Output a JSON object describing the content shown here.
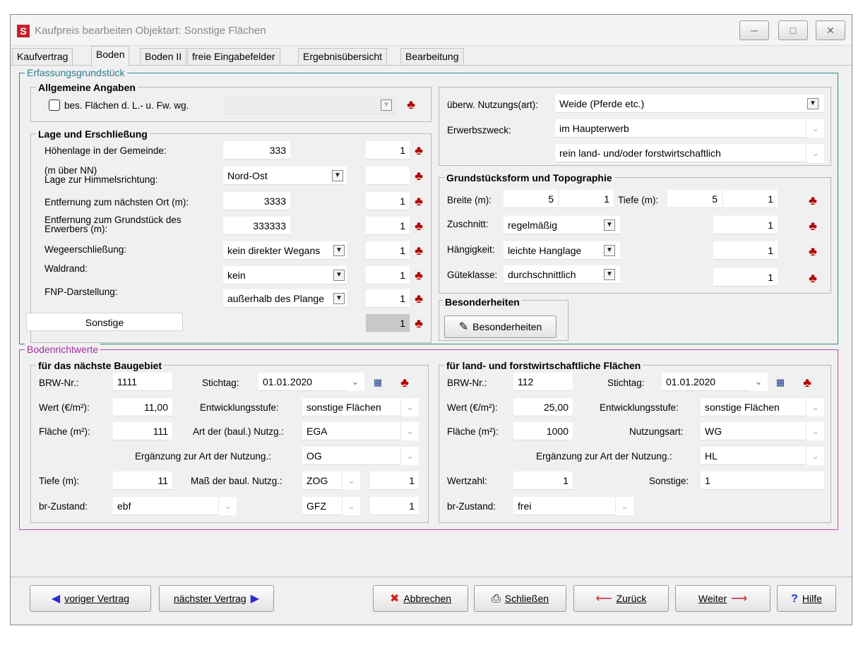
{
  "window": {
    "icon": "S",
    "title": "Kaufpreis bearbeiten  Objektart: Sonstige Flächen",
    "controls": {
      "min": "minimize-icon",
      "max": "maximize-icon",
      "close": "close-icon"
    }
  },
  "tabs": [
    "Kaufvertrag",
    "Boden",
    "Boden II",
    "freie Eingabefelder",
    "Ergebnisübersicht",
    "Bearbeitung"
  ],
  "active_tab": "Boden",
  "erfassung": {
    "title": "Erfassungsgrundstück",
    "allgemein": {
      "title": "Allgemeine Angaben",
      "checkbox_label": "bes. Flächen d. L.- u. Fw. wg.",
      "checked": false,
      "value": ""
    },
    "lage": {
      "title": "Lage und Erschließung",
      "rows": [
        {
          "label": "Höhenlage in der Gemeinde:",
          "value": "333",
          "factor": "1"
        },
        {
          "label": "(m über NN)\nLage zur Himmelsrichtung:",
          "value": "Nord-Ost",
          "factor": ""
        },
        {
          "label": "Entfernung zum nächsten Ort (m):",
          "value": "3333",
          "factor": "1"
        },
        {
          "label": "Entfernung zum Grundstück des Erwerbers (m):",
          "value": "333333",
          "factor": "1"
        },
        {
          "label": "Wegeerschließung:",
          "value": "kein direkter Wegans",
          "factor": "1"
        },
        {
          "label": "Waldrand:",
          "value": "kein",
          "factor": "1"
        },
        {
          "label": "FNP-Darstellung:",
          "value": "außerhalb des Plange",
          "factor": "1"
        }
      ],
      "sonstige_button": "Sonstige",
      "sonstige_factor": "1"
    },
    "nutzung": {
      "label1": "überw. Nutzungs(art):",
      "value1": "Weide (Pferde etc.)",
      "label2": "Erwerbszweck:",
      "value2": "im Haupterwerb",
      "value3": "rein land- und/oder forstwirtschaftlich"
    },
    "form": {
      "title": "Grundstücksform und Topographie",
      "breite_label": "Breite (m):",
      "breite": "5",
      "breite_factor": "1",
      "tiefe_label": "Tiefe (m):",
      "tiefe": "5",
      "tiefe_factor": "1",
      "rows": [
        {
          "label": "Zuschnitt:",
          "value": "regelmäßig",
          "factor": "1"
        },
        {
          "label": "Hängigkeit:",
          "value": "leichte Hanglage",
          "factor": "1"
        },
        {
          "label": "Güteklasse:",
          "value": "durchschnittlich",
          "factor": "1"
        }
      ]
    },
    "besonderheiten": {
      "title": "Besonderheiten",
      "button": "Besonderheiten"
    }
  },
  "brw": {
    "title": "Bodenrichtwerte",
    "bau": {
      "title": "für das nächste Baugebiet",
      "nr_label": "BRW-Nr.:",
      "nr": "1111",
      "stichtag_label": "Stichtag:",
      "stichtag": "01.01.2020",
      "wert_label": "Wert (€/m²):",
      "wert": "11,00",
      "entw_label": "Entwicklungsstufe:",
      "entw": "sonstige Flächen",
      "flaeche_label": "Fläche (m²):",
      "flaeche": "111",
      "art_label": "Art der (baul.) Nutzg.:",
      "art": "EGA",
      "erg_label": "Ergänzung zur Art der Nutzung.:",
      "erg": "OG",
      "tiefe_label": "Tiefe (m):",
      "tiefe": "11",
      "mass_label": "Maß der baul. Nutzg.:",
      "mass1": "ZOG",
      "mass1_val": "1",
      "mass2": "GFZ",
      "mass2_val": "1",
      "br_label": "br-Zustand:",
      "br": "ebf"
    },
    "lf": {
      "title": "für land- und forstwirtschaftliche Flächen",
      "nr_label": "BRW-Nr.:",
      "nr": "112",
      "stichtag_label": "Stichtag:",
      "stichtag": "01.01.2020",
      "wert_label": "Wert (€/m²):",
      "wert": "25,00",
      "entw_label": "Entwicklungsstufe:",
      "entw": "sonstige Flächen",
      "flaeche_label": "Fläche (m²):",
      "flaeche": "1000",
      "nutz_label": "Nutzungsart:",
      "nutz": "WG",
      "erg_label": "Ergänzung zur Art der Nutzung.:",
      "erg": "HL",
      "wertzahl_label": "Wertzahl:",
      "wertzahl": "1",
      "sonst_label": "Sonstige:",
      "sonst": "1",
      "br_label": "br-Zustand:",
      "br": "frei"
    }
  },
  "buttons": {
    "prev": "voriger Vertrag",
    "next": "nächster Vertrag",
    "cancel": "Abbrechen",
    "close": "Schließen",
    "back": "Zurück",
    "forward": "Weiter",
    "help": "Hilfe"
  }
}
